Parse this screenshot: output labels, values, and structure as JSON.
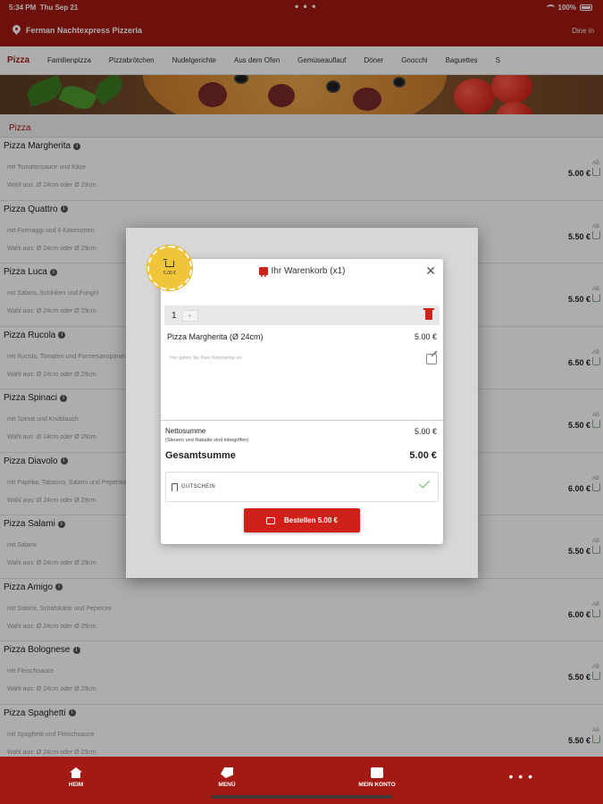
{
  "status": {
    "time": "5:34 PM",
    "date": "Thu Sep 21",
    "dots": "• • •",
    "battery": "100%"
  },
  "header": {
    "shop_name": "Ferman Nachtexpress Pizzeria",
    "login": "Dine in"
  },
  "categories": [
    "Pizza",
    "Familienpizza",
    "Pizzabrötchen",
    "Nudelgerichte",
    "Aus dem Ofen",
    "Gemüseauflauf",
    "Döner",
    "Gnocchi",
    "Baguettes",
    "S"
  ],
  "section_title": "Pizza",
  "items": [
    {
      "name": "Pizza Margherita",
      "desc": "mit Tomatensauce und Käse",
      "choose": "Wahl aus: Ø 24cm oder Ø 29cm",
      "price": "5.00 €",
      "ab": "AB"
    },
    {
      "name": "Pizza Quattro",
      "desc": "mit Formaggi und 4 Käsesorten",
      "choose": "Wahl aus: Ø 24cm oder Ø 29cm",
      "price": "5.50 €",
      "ab": "AB"
    },
    {
      "name": "Pizza Luca",
      "desc": "mit Salami, Schinken und Funghi",
      "choose": "Wahl aus: Ø 24cm oder Ø 29cm",
      "price": "5.50 €",
      "ab": "AB"
    },
    {
      "name": "Pizza Rucola",
      "desc": "mit Rucola, Tomaten und Parmesanspänen",
      "choose": "Wahl aus: Ø 24cm oder Ø 29cm",
      "price": "6.50 €",
      "ab": "AB"
    },
    {
      "name": "Pizza Spinaci",
      "desc": "mit Spinat und Knoblauch",
      "choose": "Wahl aus: Ø 24cm oder Ø 29cm",
      "price": "5.50 €",
      "ab": "AB"
    },
    {
      "name": "Pizza Diavolo",
      "desc": "mit Paprika, Tabasco, Salami und Peperoni",
      "choose": "Wahl aus: Ø 24cm oder Ø 29cm",
      "price": "6.00 €",
      "ab": "AB"
    },
    {
      "name": "Pizza Salami",
      "desc": "mit Salami",
      "choose": "Wahl aus: Ø 24cm oder Ø 29cm",
      "price": "5.50 €",
      "ab": "AB"
    },
    {
      "name": "Pizza Amigo",
      "desc": "mit Salami, Schafskäse und Peperoni",
      "choose": "Wahl aus: Ø 24cm oder Ø 29cm",
      "price": "6.00 €",
      "ab": "AB"
    },
    {
      "name": "Pizza Bolognese",
      "desc": "mit Fleischsauce",
      "choose": "Wahl aus: Ø 24cm oder Ø 29cm",
      "price": "5.50 €",
      "ab": "AB"
    },
    {
      "name": "Pizza Spaghetti",
      "desc": "mit Spaghetti und Fleischsauce",
      "choose": "Wahl aus: Ø 24cm oder Ø 29cm",
      "price": "5.50 €",
      "ab": "AB"
    }
  ],
  "cart": {
    "title": "Ihr Warenkorb (x1)",
    "badge_total": "5.00 €",
    "qty": "1",
    "plus": "+",
    "line_name": "Pizza Margherita (Ø 24cm)",
    "line_price": "5.00 €",
    "comment_placeholder": "Hier geben Sie Ihren Kommentar ein",
    "netto_label": "Nettosumme",
    "netto_sub": "(Steuern und Rabatte sind inbegriffen)",
    "netto_value": "5.00 €",
    "gesamt_label": "Gesamtsumme",
    "gesamt_value": "5.00 €",
    "voucher_label": "GUTSCHEIN",
    "order_label": "Bestellen 5.00 €"
  },
  "bottom_nav": {
    "home": "HEIM",
    "menu": "MENÜ",
    "account": "MEIN KONTO",
    "more": "• • •"
  }
}
